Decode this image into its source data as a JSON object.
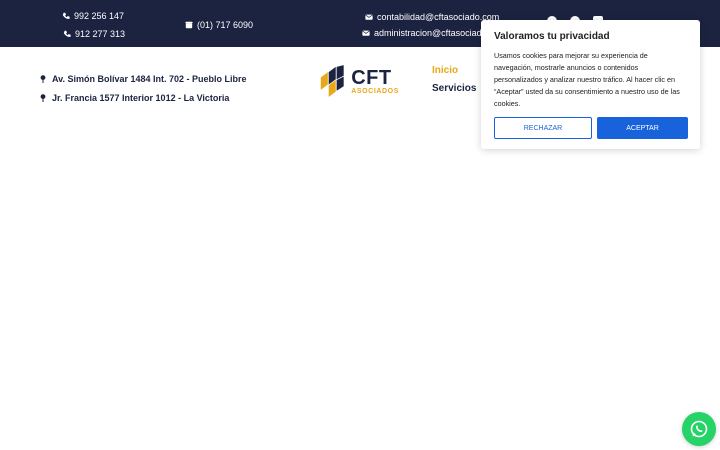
{
  "topbar": {
    "phone1": "992 256 147",
    "phone2": "912 277 313",
    "landline": "(01) 717 6090",
    "email1": "contabilidad@cftasociado.com",
    "email2": "administracion@cftasociado",
    "bg_color": "#1b2340"
  },
  "addresses": [
    "Av. Simón Bolívar 1484 Int. 702 - Pueblo Libre",
    "Jr. Francia 1577 Interior 1012 - La Victoria"
  ],
  "logo": {
    "main": "CFT",
    "sub": "ASOCIADOS"
  },
  "nav": {
    "items": [
      "Inicio",
      "Servicios"
    ],
    "active": "Inicio",
    "active_color": "#e8a81a"
  },
  "cookie_banner": {
    "title": "Valoramos tu privacidad",
    "text": "Usamos cookies para mejorar su experiencia de navegación, mostrarle anuncios o contenidos personalizados y analizar nuestro tráfico. Al hacer clic en “Aceptar” usted da su consentimiento a nuestro uso de las cookies.",
    "reject_label": "RECHAZAR",
    "accept_label": "ACEPTAR",
    "accent_color": "#1863dc"
  },
  "icons": {
    "phone": "phone-icon",
    "landline": "landline-icon",
    "email": "email-icon",
    "location": "location-pin-icon",
    "whatsapp": "whatsapp-icon"
  }
}
